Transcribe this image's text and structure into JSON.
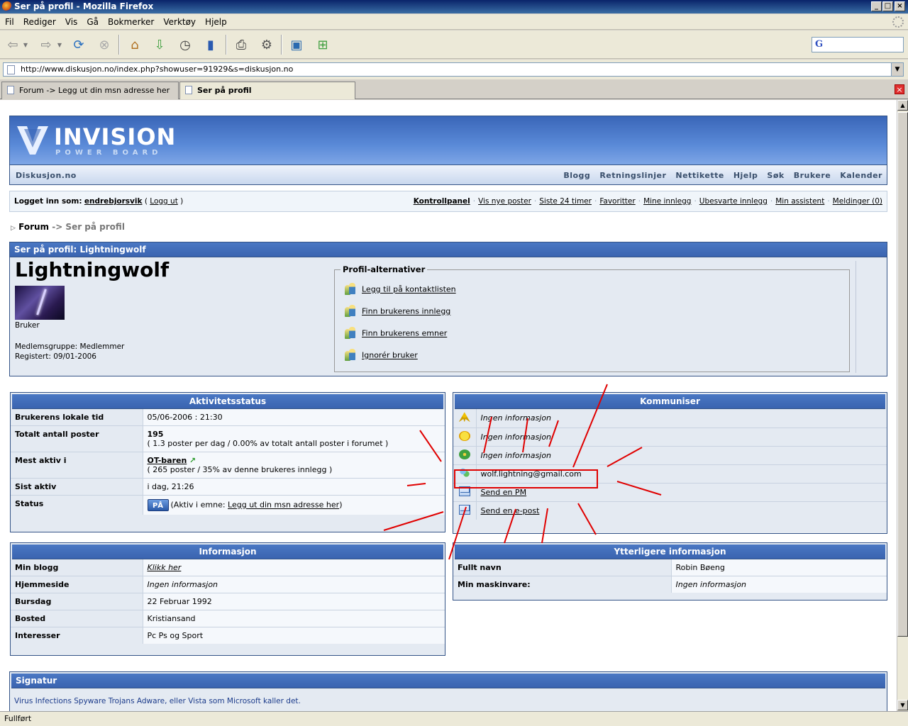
{
  "window": {
    "title": "Ser på profil - Mozilla Firefox",
    "controls": [
      "_",
      "□",
      "×"
    ]
  },
  "menu": [
    "Fil",
    "Rediger",
    "Vis",
    "Gå",
    "Bokmerker",
    "Verktøy",
    "Hjelp"
  ],
  "toolbar": {
    "icons": [
      "back-icon",
      "forward-icon",
      "reload-icon",
      "stop-icon",
      "home-icon",
      "download-icon",
      "history-icon",
      "bookmarks-icon",
      "print-icon",
      "settings-icon",
      "new-window-icon",
      "new-tab-icon"
    ],
    "search_logo": "G"
  },
  "address": "http://www.diskusjon.no/index.php?showuser=91929&s=diskusjon.no",
  "tabs": [
    {
      "label": "Forum -> Legg ut din msn adresse her",
      "active": false
    },
    {
      "label": "Ser på profil",
      "active": true
    }
  ],
  "status": "Fullført",
  "forum": {
    "logo": "INVISION",
    "logo_sub": "POWER BOARD",
    "site_name": "Diskusjon.no",
    "nav_links": [
      "Blogg",
      "Retningslinjer",
      "Nettikette",
      "Hjelp",
      "Søk",
      "Brukere",
      "Kalender"
    ],
    "logged_in_label": "Logget inn som:",
    "username": "endrebjorsvik",
    "logout": "Logg ut",
    "user_links": [
      "Kontrollpanel",
      "Vis nye poster",
      "Siste 24 timer",
      "Favoritter",
      "Mine innlegg",
      "Ubesvarte innlegg",
      "Min assistent",
      "Meldinger (0)"
    ],
    "breadcrumb": {
      "root": "Forum",
      "current": "-> Ser på profil"
    }
  },
  "profile": {
    "header": "Ser på profil: Lightningwolf",
    "name": "Lightningwolf",
    "rank": "Bruker",
    "group": "Medlemsgruppe: Medlemmer",
    "registered": "Registert: 09/01-2006",
    "options_title": "Profil-alternativer",
    "options": [
      "Legg til på kontaktlisten",
      "Finn brukerens innlegg",
      "Finn brukerens emner",
      "Ignorér bruker"
    ]
  },
  "activity": {
    "title": "Aktivitetsstatus",
    "local_time_label": "Brukerens lokale tid",
    "local_time": "05/06-2006 : 21:30",
    "posts_label": "Totalt antall poster",
    "posts": "195",
    "posts_detail": "( 1.3 poster per dag / 0.00% av totalt antall poster i forumet )",
    "most_active_label": "Mest aktiv i",
    "most_active": "OT-baren",
    "most_active_detail": "( 265 poster / 35% av denne brukeres innlegg )",
    "last_active_label": "Sist aktiv",
    "last_active": "i dag, 21:26",
    "status_label": "Status",
    "status_badge": "PÅ",
    "status_pre": "(Aktiv i emne: ",
    "status_link": "Legg ut din msn adresse her",
    "status_post": ")"
  },
  "comm": {
    "title": "Kommuniser",
    "aim": "Ingen informasjon",
    "yahoo": "Ingen informasjon",
    "icq": "Ingen informasjon",
    "msn": "wolf.lightning@gmail.com",
    "pm": "Send en PM",
    "email": "Send en e-post"
  },
  "info": {
    "title": "Informasjon",
    "blog_label": "Min blogg",
    "blog": "Klikk her",
    "homepage_label": "Hjemmeside",
    "homepage": "Ingen informasjon",
    "birthday_label": "Bursdag",
    "birthday": "22 Februar 1992",
    "location_label": "Bosted",
    "location": "Kristiansand",
    "interests_label": "Interesser",
    "interests": "Pc Ps og Sport"
  },
  "extra": {
    "title": "Ytterligere informasjon",
    "fullname_label": "Fullt navn",
    "fullname": "Robin Bøeng",
    "hardware_label": "Min maskinvare:",
    "hardware": "Ingen informasjon"
  },
  "signature": {
    "title": "Signatur",
    "text": "Virus Infections Spyware Trojans Adware, eller Vista som Microsoft kaller det."
  },
  "colors": {
    "header_blue": "#3a64b0",
    "annotation_red": "#e00000"
  }
}
